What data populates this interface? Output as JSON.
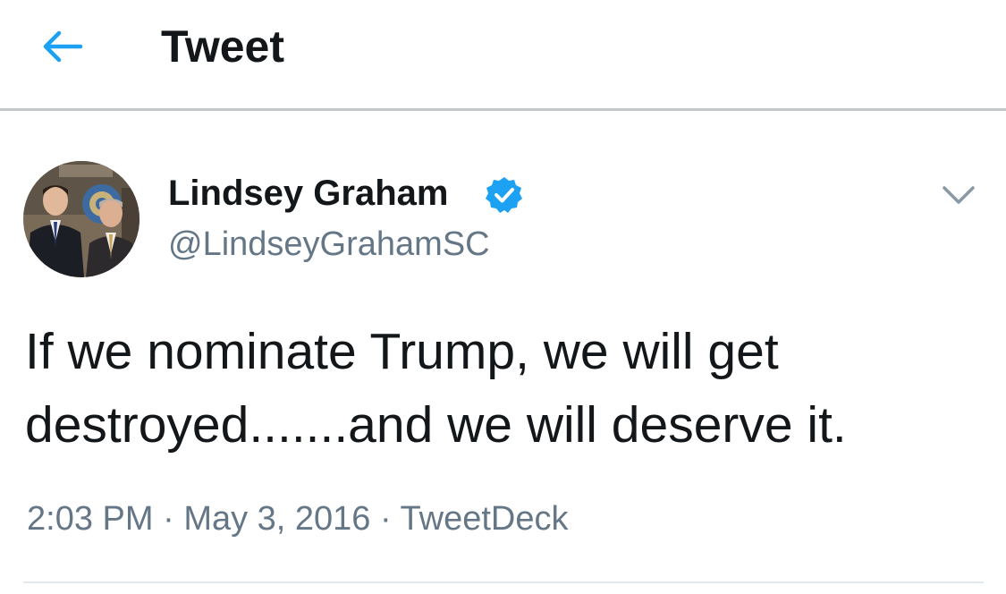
{
  "header": {
    "back_icon": "arrow-left-icon",
    "title": "Tweet"
  },
  "tweet": {
    "author": {
      "name": "Lindsey Graham",
      "handle": "@LindseyGrahamSC",
      "verified": true,
      "verified_icon": "verified-badge-icon",
      "avatar": "author-avatar"
    },
    "menu_icon": "chevron-down-icon",
    "text": "If we nominate Trump, we will get\ndestroyed.......and we will deserve it.",
    "time": "2:03 PM",
    "date": "May 3, 2016",
    "source": "TweetDeck",
    "separator": "·"
  },
  "colors": {
    "accent": "#1da1f2",
    "text": "#14171a",
    "secondary_text": "#657786",
    "divider": "#c4c8cc"
  }
}
